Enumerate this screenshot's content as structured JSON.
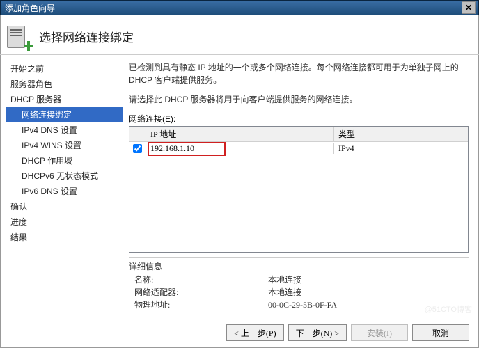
{
  "window": {
    "title": "添加角色向导"
  },
  "header": {
    "title": "选择网络连接绑定"
  },
  "sidebar": {
    "items": [
      {
        "label": "开始之前"
      },
      {
        "label": "服务器角色"
      },
      {
        "label": "DHCP 服务器"
      },
      {
        "label": "网络连接绑定",
        "selected": true,
        "sub": true
      },
      {
        "label": "IPv4 DNS 设置",
        "sub": true
      },
      {
        "label": "IPv4 WINS 设置",
        "sub": true
      },
      {
        "label": "DHCP 作用域",
        "sub": true
      },
      {
        "label": "DHCPv6 无状态模式",
        "sub": true
      },
      {
        "label": "IPv6 DNS 设置",
        "sub": true
      },
      {
        "label": "确认"
      },
      {
        "label": "进度"
      },
      {
        "label": "结果"
      }
    ]
  },
  "main": {
    "desc1": "已检测到具有静态 IP 地址的一个或多个网络连接。每个网络连接都可用于为单独子网上的 DHCP 客户端提供服务。",
    "desc2": "请选择此 DHCP 服务器将用于向客户端提供服务的网络连接。",
    "grid_label": "网络连接(E):",
    "columns": {
      "ip": "IP 地址",
      "type": "类型"
    },
    "row": {
      "ip": "192.168.1.10",
      "type": "IPv4",
      "checked": true
    },
    "details": {
      "header": "详细信息",
      "name_label": "名称:",
      "name_value": "本地连接",
      "adapter_label": "网络适配器:",
      "adapter_value": "本地连接",
      "mac_label": "物理地址:",
      "mac_value": "00-0C-29-5B-0F-FA"
    }
  },
  "footer": {
    "prev": "< 上一步(P)",
    "next": "下一步(N) >",
    "install": "安装(I)",
    "cancel": "取消"
  },
  "watermark": "@51CTO博客"
}
